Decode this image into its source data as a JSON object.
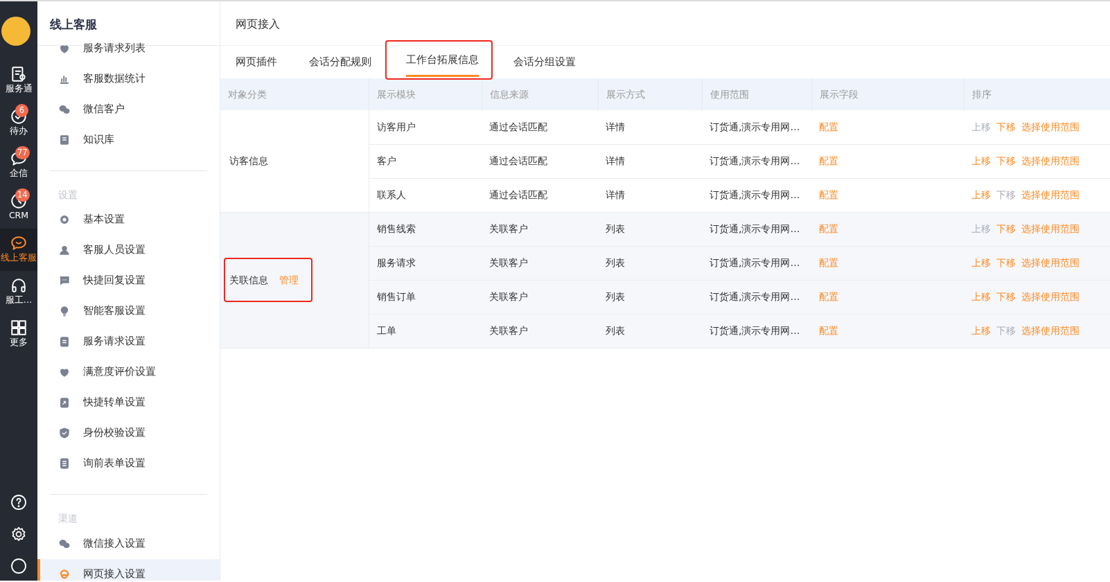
{
  "rail": {
    "items": [
      {
        "label": "服务通",
        "selected": false
      },
      {
        "label": "待办",
        "badge": "6",
        "selected": false
      },
      {
        "label": "企信",
        "badge": "77",
        "selected": false
      },
      {
        "label": "CRM",
        "badge": "14",
        "selected": false
      },
      {
        "label": "线上客服",
        "selected": true
      },
      {
        "label": "服工…",
        "selected": false
      },
      {
        "label": "更多",
        "selected": false
      }
    ]
  },
  "sidebar": {
    "title": "线上客服",
    "sections": [
      {
        "items": [
          {
            "label": "服务请求列表",
            "selected": false
          },
          {
            "label": "客服数据统计",
            "selected": false
          },
          {
            "label": "微信客户",
            "selected": false
          },
          {
            "label": "知识库",
            "selected": false
          }
        ]
      },
      {
        "header": "设置",
        "items": [
          {
            "label": "基本设置",
            "selected": false
          },
          {
            "label": "客服人员设置",
            "selected": false
          },
          {
            "label": "快捷回复设置",
            "selected": false
          },
          {
            "label": "智能客服设置",
            "selected": false
          },
          {
            "label": "服务请求设置",
            "selected": false
          },
          {
            "label": "满意度评价设置",
            "selected": false
          },
          {
            "label": "快捷转单设置",
            "selected": false
          },
          {
            "label": "身份校验设置",
            "selected": false
          },
          {
            "label": "询前表单设置",
            "selected": false
          }
        ]
      },
      {
        "header": "渠道",
        "items": [
          {
            "label": "微信接入设置",
            "selected": false
          },
          {
            "label": "网页接入设置",
            "selected": true
          }
        ]
      }
    ]
  },
  "page": {
    "title": "网页接入"
  },
  "tabs": [
    {
      "label": "网页插件",
      "selected": false,
      "highlighted": false
    },
    {
      "label": "会话分配规则",
      "selected": false,
      "highlighted": false
    },
    {
      "label": "工作台拓展信息",
      "selected": true,
      "highlighted": true
    },
    {
      "label": "会话分组设置",
      "selected": false,
      "highlighted": false
    }
  ],
  "table": {
    "columns": [
      "对象分类",
      "展示模块",
      "信息来源",
      "展示方式",
      "使用范围",
      "展示字段",
      "排序"
    ],
    "groups": [
      {
        "category": "访客信息",
        "highlighted": false,
        "rows": [
          {
            "module": "访客用户",
            "source": "通过会话匹配",
            "display": "详情",
            "scope": "订货通,演示专用网…",
            "fields": "配置",
            "up": "上移",
            "up_disabled": true,
            "down": "下移",
            "down_disabled": false,
            "range": "选择使用范围"
          },
          {
            "module": "客户",
            "source": "通过会话匹配",
            "display": "详情",
            "scope": "订货通,演示专用网…",
            "fields": "配置",
            "up": "上移",
            "up_disabled": false,
            "down": "下移",
            "down_disabled": false,
            "range": "选择使用范围"
          },
          {
            "module": "联系人",
            "source": "通过会话匹配",
            "display": "详情",
            "scope": "订货通,演示专用网…",
            "fields": "配置",
            "up": "上移",
            "up_disabled": false,
            "down": "下移",
            "down_disabled": true,
            "range": "选择使用范围"
          }
        ]
      },
      {
        "category": "关联信息",
        "action": "管理",
        "highlighted": true,
        "rows": [
          {
            "module": "销售线索",
            "source": "关联客户",
            "display": "列表",
            "scope": "订货通,演示专用网…",
            "fields": "配置",
            "up": "上移",
            "up_disabled": true,
            "down": "下移",
            "down_disabled": false,
            "range": "选择使用范围"
          },
          {
            "module": "服务请求",
            "source": "关联客户",
            "display": "列表",
            "scope": "订货通,演示专用网…",
            "fields": "配置",
            "up": "上移",
            "up_disabled": false,
            "down": "下移",
            "down_disabled": false,
            "range": "选择使用范围"
          },
          {
            "module": "销售订单",
            "source": "关联客户",
            "display": "列表",
            "scope": "订货通,演示专用网…",
            "fields": "配置",
            "up": "上移",
            "up_disabled": false,
            "down": "下移",
            "down_disabled": false,
            "range": "选择使用范围"
          },
          {
            "module": "工单",
            "source": "关联客户",
            "display": "列表",
            "scope": "订货通,演示专用网…",
            "fields": "配置",
            "up": "上移",
            "up_disabled": false,
            "down": "下移",
            "down_disabled": true,
            "range": "选择使用范围"
          }
        ]
      }
    ]
  }
}
